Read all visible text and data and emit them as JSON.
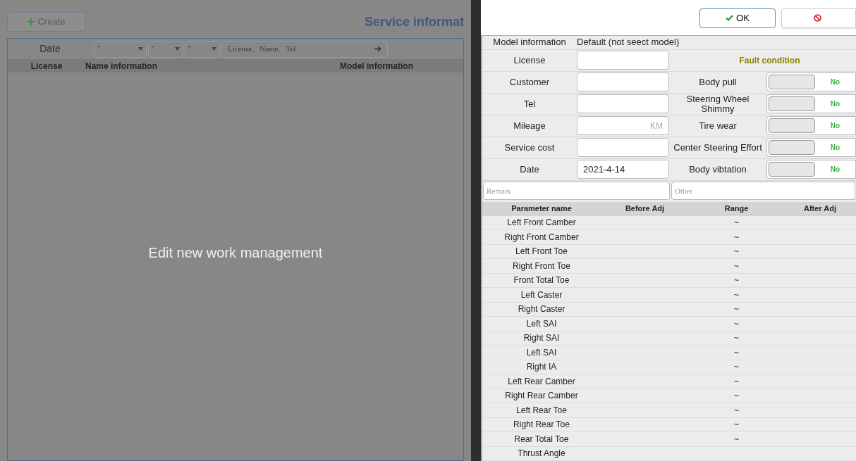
{
  "background": {
    "create_button": "Create",
    "title": "Service informat",
    "filter": {
      "label": "Date",
      "dropdowns": [
        "*",
        "*",
        "*"
      ],
      "search_placeholder": "License、Name、Tel"
    },
    "columns": [
      "License",
      "Name information",
      "Model information"
    ],
    "message": "Edit new work management"
  },
  "dialog": {
    "buttons": [
      {
        "kind": "ok",
        "label": "OK"
      },
      {
        "kind": "cancel"
      }
    ],
    "model_info": {
      "label": "Model information",
      "value": "Default (not seect model)"
    },
    "fault_title": "Fault condition",
    "fields": [
      {
        "label": "License"
      },
      {
        "label": "Customer"
      },
      {
        "label": "Tel"
      },
      {
        "label": "Mileage",
        "unit": "KM"
      },
      {
        "label": "Service cost"
      },
      {
        "label": "Date",
        "value": "2021-4-14"
      }
    ],
    "faults": [
      {
        "label": "Body pull",
        "on": false,
        "state_text": "No"
      },
      {
        "label": "Steering Wheel Shimmy",
        "on": false,
        "state_text": "No"
      },
      {
        "label": "Tire wear",
        "on": false,
        "state_text": "No"
      },
      {
        "label": "Center Steering Effort",
        "on": false,
        "state_text": "No"
      },
      {
        "label": "Body vibtation",
        "on": false,
        "state_text": "No"
      }
    ],
    "remark_placeholder": "Remark",
    "other_placeholder": "Other",
    "table": {
      "columns": [
        "Parameter name",
        "Before Adj",
        "Range",
        "After Adj"
      ],
      "rows": [
        {
          "name": "Left Front Camber",
          "range": "~"
        },
        {
          "name": "Right Front Camber",
          "range": "~"
        },
        {
          "name": "Left Front Toe",
          "range": "~"
        },
        {
          "name": "Right Front Toe",
          "range": "~"
        },
        {
          "name": "Front Total Toe",
          "range": "~"
        },
        {
          "name": "Left Caster",
          "range": "~"
        },
        {
          "name": "Right Caster",
          "range": "~"
        },
        {
          "name": "Left SAI",
          "range": "~"
        },
        {
          "name": "Right SAI",
          "range": "~"
        },
        {
          "name": "Left SAI",
          "range": "~"
        },
        {
          "name": "Right IA",
          "range": "~"
        },
        {
          "name": "Left Rear Camber",
          "range": "~"
        },
        {
          "name": "Right Rear Camber",
          "range": "~"
        },
        {
          "name": "Left Rear Toe",
          "range": "~"
        },
        {
          "name": "Right Rear Toe",
          "range": "~"
        },
        {
          "name": "Rear Total Toe",
          "range": "~"
        },
        {
          "name": "Thrust Angle"
        }
      ]
    }
  }
}
